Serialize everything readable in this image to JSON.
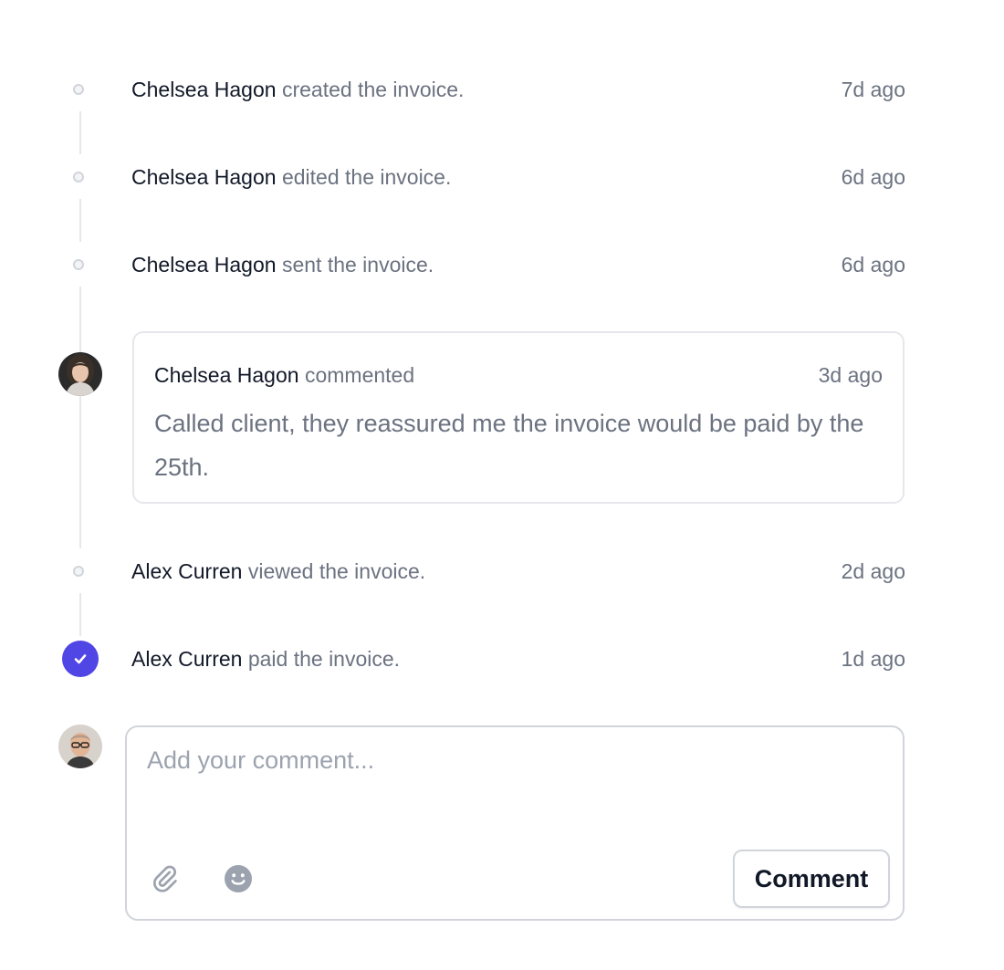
{
  "activity": [
    {
      "actor": "Chelsea Hagon",
      "action": "created the invoice.",
      "time": "7d ago"
    },
    {
      "actor": "Chelsea Hagon",
      "action": "edited the invoice.",
      "time": "6d ago"
    },
    {
      "actor": "Chelsea Hagon",
      "action": "sent the invoice.",
      "time": "6d ago"
    },
    {
      "actor": "Alex Curren",
      "action": "viewed the invoice.",
      "time": "2d ago"
    },
    {
      "actor": "Alex Curren",
      "action": "paid the invoice.",
      "time": "1d ago"
    }
  ],
  "comment": {
    "author": "Chelsea Hagon",
    "verb": "commented",
    "time": "3d ago",
    "body": "Called client, they reassured me the invoice would be paid by the 25th."
  },
  "compose": {
    "placeholder": "Add your comment...",
    "submit_label": "Comment"
  },
  "icons": {
    "attach": "paperclip-icon",
    "emoji": "face-smile-icon",
    "paid": "check-circle-icon"
  },
  "colors": {
    "accent": "#4f46e5",
    "line": "#e5e7eb",
    "muted_text": "#6b7280",
    "strong_text": "#111827",
    "placeholder": "#9ca3af"
  }
}
